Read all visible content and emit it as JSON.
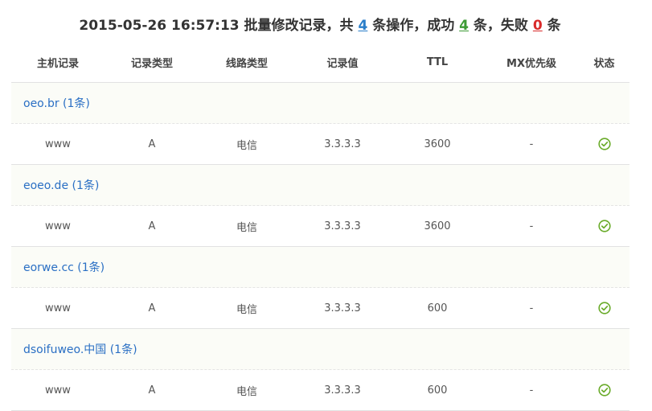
{
  "title": {
    "timestamp": "2015-05-26 16:57:13",
    "prefix": "批量修改记录，共",
    "total": "4",
    "mid1": "条操作，成功",
    "success": "4",
    "mid2": "条，失败",
    "fail": "0",
    "suffix": "条"
  },
  "columns": [
    "主机记录",
    "记录类型",
    "线路类型",
    "记录值",
    "TTL",
    "MX优先级",
    "状态"
  ],
  "groups": [
    {
      "domain": "oeo.br (1条)",
      "record": {
        "host": "www",
        "type": "A",
        "line": "电信",
        "value": "3.3.3.3",
        "ttl": "3600",
        "mx": "-",
        "status_icon": "check-circle-icon"
      }
    },
    {
      "domain": "eoeo.de (1条)",
      "record": {
        "host": "www",
        "type": "A",
        "line": "电信",
        "value": "3.3.3.3",
        "ttl": "3600",
        "mx": "-",
        "status_icon": "check-circle-icon"
      }
    },
    {
      "domain": "eorwe.cc (1条)",
      "record": {
        "host": "www",
        "type": "A",
        "line": "电信",
        "value": "3.3.3.3",
        "ttl": "600",
        "mx": "-",
        "status_icon": "check-circle-icon"
      }
    },
    {
      "domain": "dsoifuweo.中国 (1条)",
      "record": {
        "host": "www",
        "type": "A",
        "line": "电信",
        "value": "3.3.3.3",
        "ttl": "600",
        "mx": "-",
        "status_icon": "check-circle-icon"
      }
    }
  ],
  "colors": {
    "link": "#2a6fc4",
    "success": "#3d9b35",
    "fail": "#d92a2a",
    "total": "#2a7ec9",
    "check": "#6aab2a"
  }
}
